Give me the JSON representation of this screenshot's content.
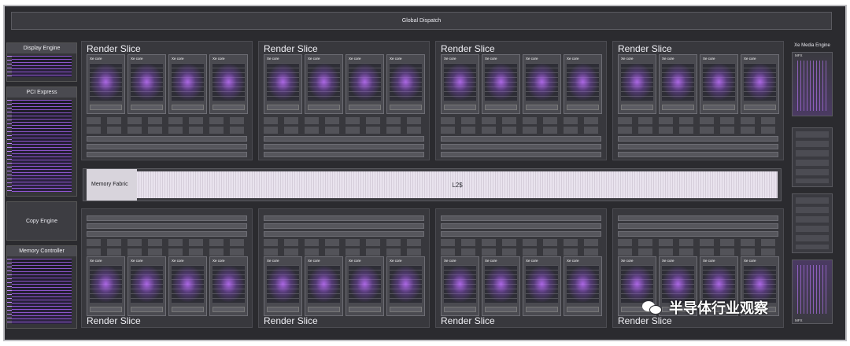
{
  "header": {
    "dispatch_label": "Global Dispatch"
  },
  "left_column": {
    "display_engine": "Display Engine",
    "pci_express": "PCI Express",
    "copy_engine": "Copy Engine",
    "memory_controller": "Memory Controller"
  },
  "slices": {
    "top": [
      "Render Slice",
      "Render Slice",
      "Render Slice",
      "Render Slice"
    ],
    "bottom": [
      "Render Slice",
      "Render Slice",
      "Render Slice",
      "Render Slice"
    ]
  },
  "core_label": "Xe core",
  "fabric": {
    "label": "Memory Fabric",
    "cache": "L2$"
  },
  "right_column": {
    "title": "Xe Media Engine",
    "mfx_top": "MFX",
    "mfx_bottom": "MFX"
  },
  "watermark": {
    "text": "半导体行业观察"
  }
}
